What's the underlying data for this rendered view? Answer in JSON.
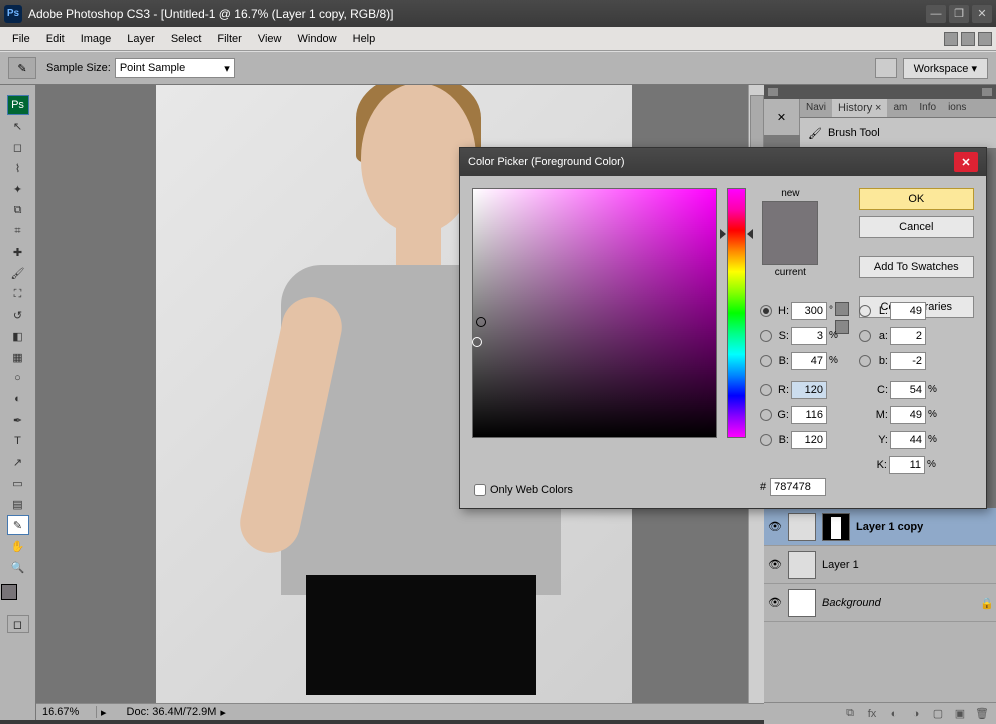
{
  "titlebar": {
    "app_icon": "Ps",
    "title": "Adobe Photoshop CS3 - [Untitled-1 @ 16.7% (Layer 1 copy, RGB/8)]"
  },
  "menu": [
    "File",
    "Edit",
    "Image",
    "Layer",
    "Select",
    "Filter",
    "View",
    "Window",
    "Help"
  ],
  "options": {
    "sample_label": "Sample Size:",
    "sample_value": "Point Sample",
    "workspace_label": "Workspace ▾"
  },
  "status": {
    "zoom": "16.67%",
    "doc": "Doc: 36.4M/72.9M"
  },
  "palette_tabs": [
    "Navi",
    "History",
    "am",
    "Info",
    "ions"
  ],
  "history_item": "Brush Tool",
  "layers": [
    {
      "name": "Layer 1 copy",
      "active": true,
      "mask": true
    },
    {
      "name": "Layer 1",
      "active": false,
      "mask": false
    },
    {
      "name": "Background",
      "active": false,
      "mask": false,
      "locked": true,
      "italic": true
    }
  ],
  "color_picker": {
    "title": "Color Picker (Foreground Color)",
    "new_label": "new",
    "current_label": "current",
    "buttons": {
      "ok": "OK",
      "cancel": "Cancel",
      "swatches": "Add To Swatches",
      "libraries": "Color Libraries"
    },
    "web_only": "Only Web Colors",
    "values": {
      "H": "300",
      "H_u": "°",
      "S": "3",
      "S_u": "%",
      "B": "47",
      "B_u": "%",
      "R": "120",
      "G": "116",
      "Bl": "120",
      "L": "49",
      "a": "2",
      "b": "-2",
      "C": "54",
      "M": "49",
      "Y": "44",
      "K": "11",
      "hex": "787478"
    }
  }
}
